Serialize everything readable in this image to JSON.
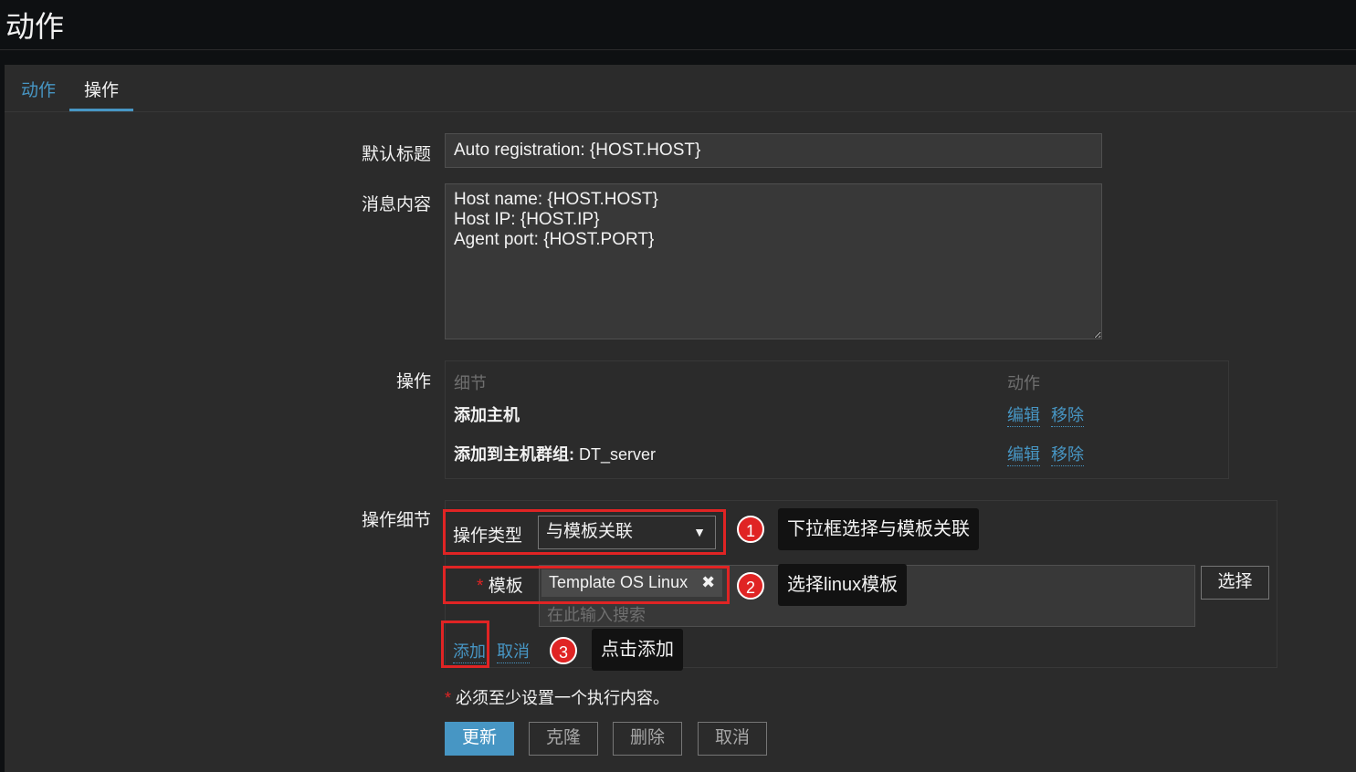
{
  "header": {
    "title": "动作"
  },
  "tabs": [
    {
      "label": "动作"
    },
    {
      "label": "操作"
    }
  ],
  "form": {
    "default_subject_label": "默认标题",
    "default_subject_value": "Auto registration: {HOST.HOST}",
    "message_label": "消息内容",
    "message_value": "Host name: {HOST.HOST}\nHost IP: {HOST.IP}\nAgent port: {HOST.PORT}",
    "operations_label": "操作",
    "operations_table": {
      "col_details": "细节",
      "col_action": "动作",
      "rows": [
        {
          "detail_bold": "添加主机",
          "detail_rest": "",
          "edit": "编辑",
          "remove": "移除"
        },
        {
          "detail_bold": "添加到主机群组:",
          "detail_rest": " DT_server",
          "edit": "编辑",
          "remove": "移除"
        }
      ]
    },
    "op_details_label": "操作细节",
    "op_type_label": "操作类型",
    "op_type_value": "与模板关联",
    "template_required_mark": "*",
    "template_label": "模板",
    "template_chip": "Template OS Linux",
    "template_placeholder": "在此输入搜索",
    "select_button": "选择",
    "add_link": "添加",
    "cancel_link": "取消",
    "required_note_mark": "*",
    "required_note": " 必须至少设置一个执行内容。",
    "buttons": {
      "update": "更新",
      "clone": "克隆",
      "delete": "删除",
      "cancel": "取消"
    }
  },
  "annotations": [
    {
      "num": "1",
      "text": "下拉框选择与模板关联"
    },
    {
      "num": "2",
      "text": "选择linux模板"
    },
    {
      "num": "3",
      "text": "点击添加"
    }
  ],
  "colors": {
    "accent": "#4796c4",
    "highlight": "#e02424",
    "background": "#2b2b2b"
  }
}
